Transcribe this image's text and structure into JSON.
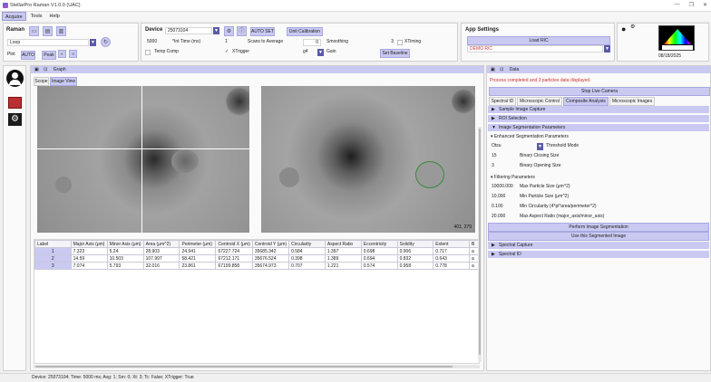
{
  "window": {
    "title": "StellarPro Raman V1.0.0 (UAC)",
    "controls": [
      "—",
      "❐",
      "✕"
    ]
  },
  "menu": [
    "Acquire",
    "Tools",
    "Help"
  ],
  "raman": {
    "label": "Raman",
    "mode": "Loop",
    "plot_label": "Plot",
    "plot_auto": "AUTO",
    "peak": "Peak"
  },
  "device": {
    "label": "Device",
    "id": "25073104",
    "auto_set": "AUTO SET",
    "unit_calibration": "Unit Calibration",
    "int_time_value": "5000",
    "int_time_label": "*Int Time (ms)",
    "scans_value": "1",
    "scans_label": "Scans to Average",
    "smoothing_value": "0",
    "smoothing_label": "Smoothing",
    "xtiming_value": "3",
    "xtiming_label": "XTiming",
    "temp_comp_label": "Temp Comp",
    "xtrigger_label": "XTrigger",
    "gain_value": "g4",
    "gain_label": "Gain",
    "set_baseline": "Set Baseline"
  },
  "app_settings": {
    "label": "App Settings",
    "load_ric": "Load RIC",
    "ric_value": "DEMO RIC",
    "date": "08/18/2025"
  },
  "graph": {
    "title": "Graph",
    "tabs": [
      "Scope",
      "Image View"
    ],
    "coord_readout": "401, 279"
  },
  "table": {
    "headers": [
      "Label",
      "Major Axis (μm)",
      "Minor Axis (μm)",
      "Area (μm^2)",
      "Perimeter (μm)",
      "Centroid X (μm)",
      "Centroid Y (μm)",
      "Circularity",
      "Aspect Ratio",
      "Eccentricity",
      "Solidity",
      "Extent",
      "B"
    ],
    "rows": [
      [
        "1",
        "7.323",
        "5.24",
        "28.903",
        "24.941",
        "67227.724",
        "35685.342",
        "0.584",
        "1.397",
        "0.698",
        "0.906",
        "0.717",
        "a"
      ],
      [
        "2",
        "14.59",
        "10.503",
        "107.997",
        "58.421",
        "67212.171",
        "35676.524",
        "0.398",
        "1.389",
        "0.694",
        "0.832",
        "0.643",
        "a"
      ],
      [
        "3",
        "7.074",
        "5.793",
        "32.016",
        "23.861",
        "67199.858",
        "35674.973",
        "0.707",
        "1.221",
        "0.574",
        "0.958",
        "0.778",
        "a"
      ]
    ]
  },
  "data_panel": {
    "title": "Data",
    "status": "Process completed and 3 particles data displayed.",
    "stop_camera": "Stop Live Camera",
    "tabs": [
      "Spectral ID",
      "Microscopic Control",
      "Composite Analysis",
      "Microscopic Images"
    ],
    "sections": {
      "sample_image_capture": "Sample Image Capture",
      "roi_selection": "ROI Selection",
      "image_segmentation": "Image Segmentation Parameters",
      "spectral_capture": "Spectral Capture",
      "spectral_id": "Spectral ID"
    },
    "enhanced_seg": "Enhanced Segmentation Parameters",
    "threshold_value": "Otsu",
    "threshold_label": "Threshold Mode",
    "closing_value": "15",
    "closing_label": "Binary Closing Size",
    "opening_value": "3",
    "opening_label": "Binary Opening Size",
    "filtering": "Filtering Parameters",
    "max_particle_value": "10000.000",
    "max_particle_label": "Max Particle Size (μm^2)",
    "min_particle_value": "10.000",
    "min_particle_label": "Min Particle Size (μm^2)",
    "min_circ_value": "0.100",
    "min_circ_label": "Min Circularity (4*pi*area/perimeter^2)",
    "max_aspect_value": "20.000",
    "max_aspect_label": "Max Aspect Ratio (major_axis/minor_axis)",
    "perform_seg": "Perform Image Segmentation",
    "use_seg": "Use this Segmented Image"
  },
  "status_bar": "Device: 25073104; Time: 5000 ms; Avg: 1; Sm: 0; Xt: 3; Tc: False; XTrigger: True"
}
